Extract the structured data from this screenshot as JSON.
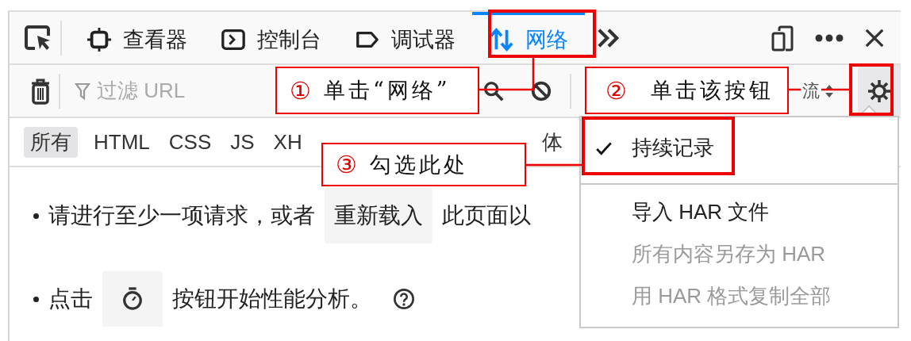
{
  "tabs": [
    {
      "label": "查看器",
      "selected": false
    },
    {
      "label": "控制台",
      "selected": false
    },
    {
      "label": "调试器",
      "selected": false
    },
    {
      "label": "网络",
      "selected": true
    }
  ],
  "toolbar": {
    "filter_placeholder": "过滤 URL",
    "throttle_label": "流"
  },
  "filter_tabs": [
    {
      "label": "所有",
      "selected": true
    },
    {
      "label": "HTML",
      "selected": false
    },
    {
      "label": "CSS",
      "selected": false
    },
    {
      "label": "JS",
      "selected": false
    },
    {
      "label": "XH",
      "selected": false
    },
    {
      "label": "体",
      "selected": false
    }
  ],
  "content": {
    "line_1": {
      "before": "请进行至少一项请求，或者",
      "button": "重新载入",
      "after": "此页面以"
    },
    "line_2": {
      "before": "点击",
      "after": "按钮开始性能分析。"
    }
  },
  "settings_menu": {
    "groups": [
      [
        {
          "label": "持续记录",
          "checked": true,
          "disabled": false
        }
      ],
      [
        {
          "label": "导入 HAR 文件",
          "checked": false,
          "disabled": false
        },
        {
          "label": "所有内容另存为 HAR",
          "checked": false,
          "disabled": true
        },
        {
          "label": "用 HAR 格式复制全部",
          "checked": false,
          "disabled": true
        }
      ]
    ]
  },
  "annotations": [
    {
      "number": "①",
      "text": "单击“网络”"
    },
    {
      "number": "②",
      "text": "单击该按钮"
    },
    {
      "number": "③",
      "text": "勾选此处"
    }
  ]
}
